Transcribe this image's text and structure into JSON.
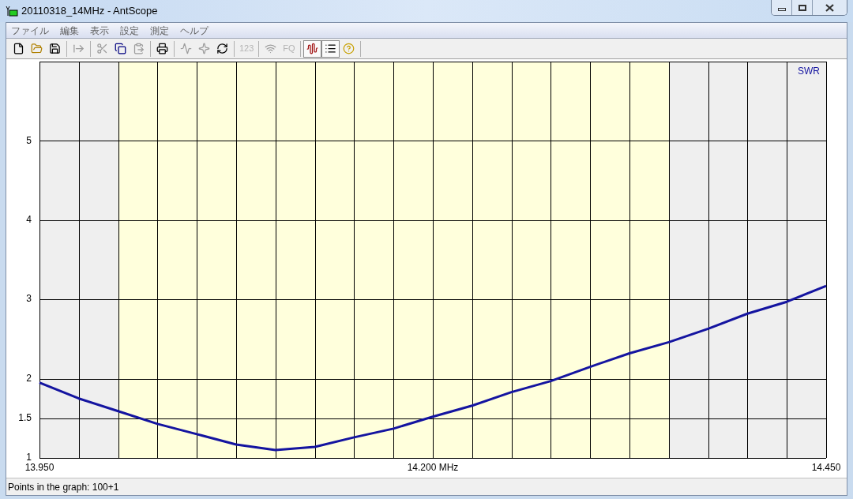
{
  "window": {
    "title": "20110318_14MHz - AntScope"
  },
  "menu": [
    {
      "label": "ファイル"
    },
    {
      "label": "編集"
    },
    {
      "label": "表示"
    },
    {
      "label": "設定"
    },
    {
      "label": "測定"
    },
    {
      "label": "ヘルプ"
    }
  ],
  "toolbar": [
    {
      "kind": "icon",
      "disabled": false,
      "pressed": false
    },
    {
      "kind": "icon",
      "disabled": false,
      "pressed": false
    },
    {
      "kind": "icon",
      "disabled": false,
      "pressed": false
    },
    {
      "kind": "separator"
    },
    {
      "kind": "icon",
      "disabled": true,
      "pressed": false
    },
    {
      "kind": "separator"
    },
    {
      "kind": "icon",
      "disabled": true,
      "pressed": false
    },
    {
      "kind": "icon",
      "disabled": false,
      "pressed": false
    },
    {
      "kind": "icon",
      "disabled": true,
      "pressed": false
    },
    {
      "kind": "separator"
    },
    {
      "kind": "icon",
      "disabled": false,
      "pressed": false
    },
    {
      "kind": "separator"
    },
    {
      "kind": "icon",
      "disabled": true,
      "pressed": false
    },
    {
      "kind": "icon",
      "disabled": true,
      "pressed": false
    },
    {
      "kind": "icon",
      "disabled": false,
      "pressed": false
    },
    {
      "kind": "separator"
    },
    {
      "kind": "text",
      "label": "123",
      "disabled": true,
      "pressed": false
    },
    {
      "kind": "separator"
    },
    {
      "kind": "icon",
      "disabled": true,
      "pressed": false
    },
    {
      "kind": "text",
      "label": "FQ",
      "disabled": true,
      "pressed": false
    },
    {
      "kind": "separator"
    },
    {
      "kind": "icon",
      "disabled": false,
      "pressed": true
    },
    {
      "kind": "icon",
      "disabled": false,
      "pressed": true
    },
    {
      "kind": "icon",
      "disabled": false,
      "pressed": false
    },
    {
      "kind": "separator"
    }
  ],
  "chart": {
    "chart_data": {
      "type": "line",
      "xlim": [
        13.95,
        14.45
      ],
      "ylim": [
        1,
        6
      ],
      "xticks": [
        {
          "value": 13.95,
          "label": "13.950"
        },
        {
          "value": 14.2,
          "label": "14.200 MHz"
        },
        {
          "value": 14.45,
          "label": "14.450"
        }
      ],
      "yticks": [
        1,
        1.5,
        2,
        3,
        4,
        5
      ],
      "x": [
        13.95,
        13.975,
        14.0,
        14.025,
        14.05,
        14.075,
        14.1,
        14.125,
        14.15,
        14.175,
        14.2,
        14.225,
        14.25,
        14.275,
        14.3,
        14.325,
        14.35,
        14.375,
        14.4,
        14.425,
        14.45
      ],
      "series": [
        {
          "name": "SWR",
          "color": "#1414a0",
          "values": [
            1.95,
            1.75,
            1.59,
            1.43,
            1.3,
            1.17,
            1.1,
            1.14,
            1.26,
            1.37,
            1.52,
            1.66,
            1.83,
            1.97,
            2.15,
            2.32,
            2.46,
            2.63,
            2.82,
            2.97,
            3.17
          ]
        }
      ],
      "grid": true,
      "bands": [
        {
          "axis": "x",
          "from": 14.0,
          "to": 14.35,
          "color": "#ffffdc"
        }
      ]
    }
  },
  "status_bar": {
    "text": "Points in the graph: 100+1"
  }
}
